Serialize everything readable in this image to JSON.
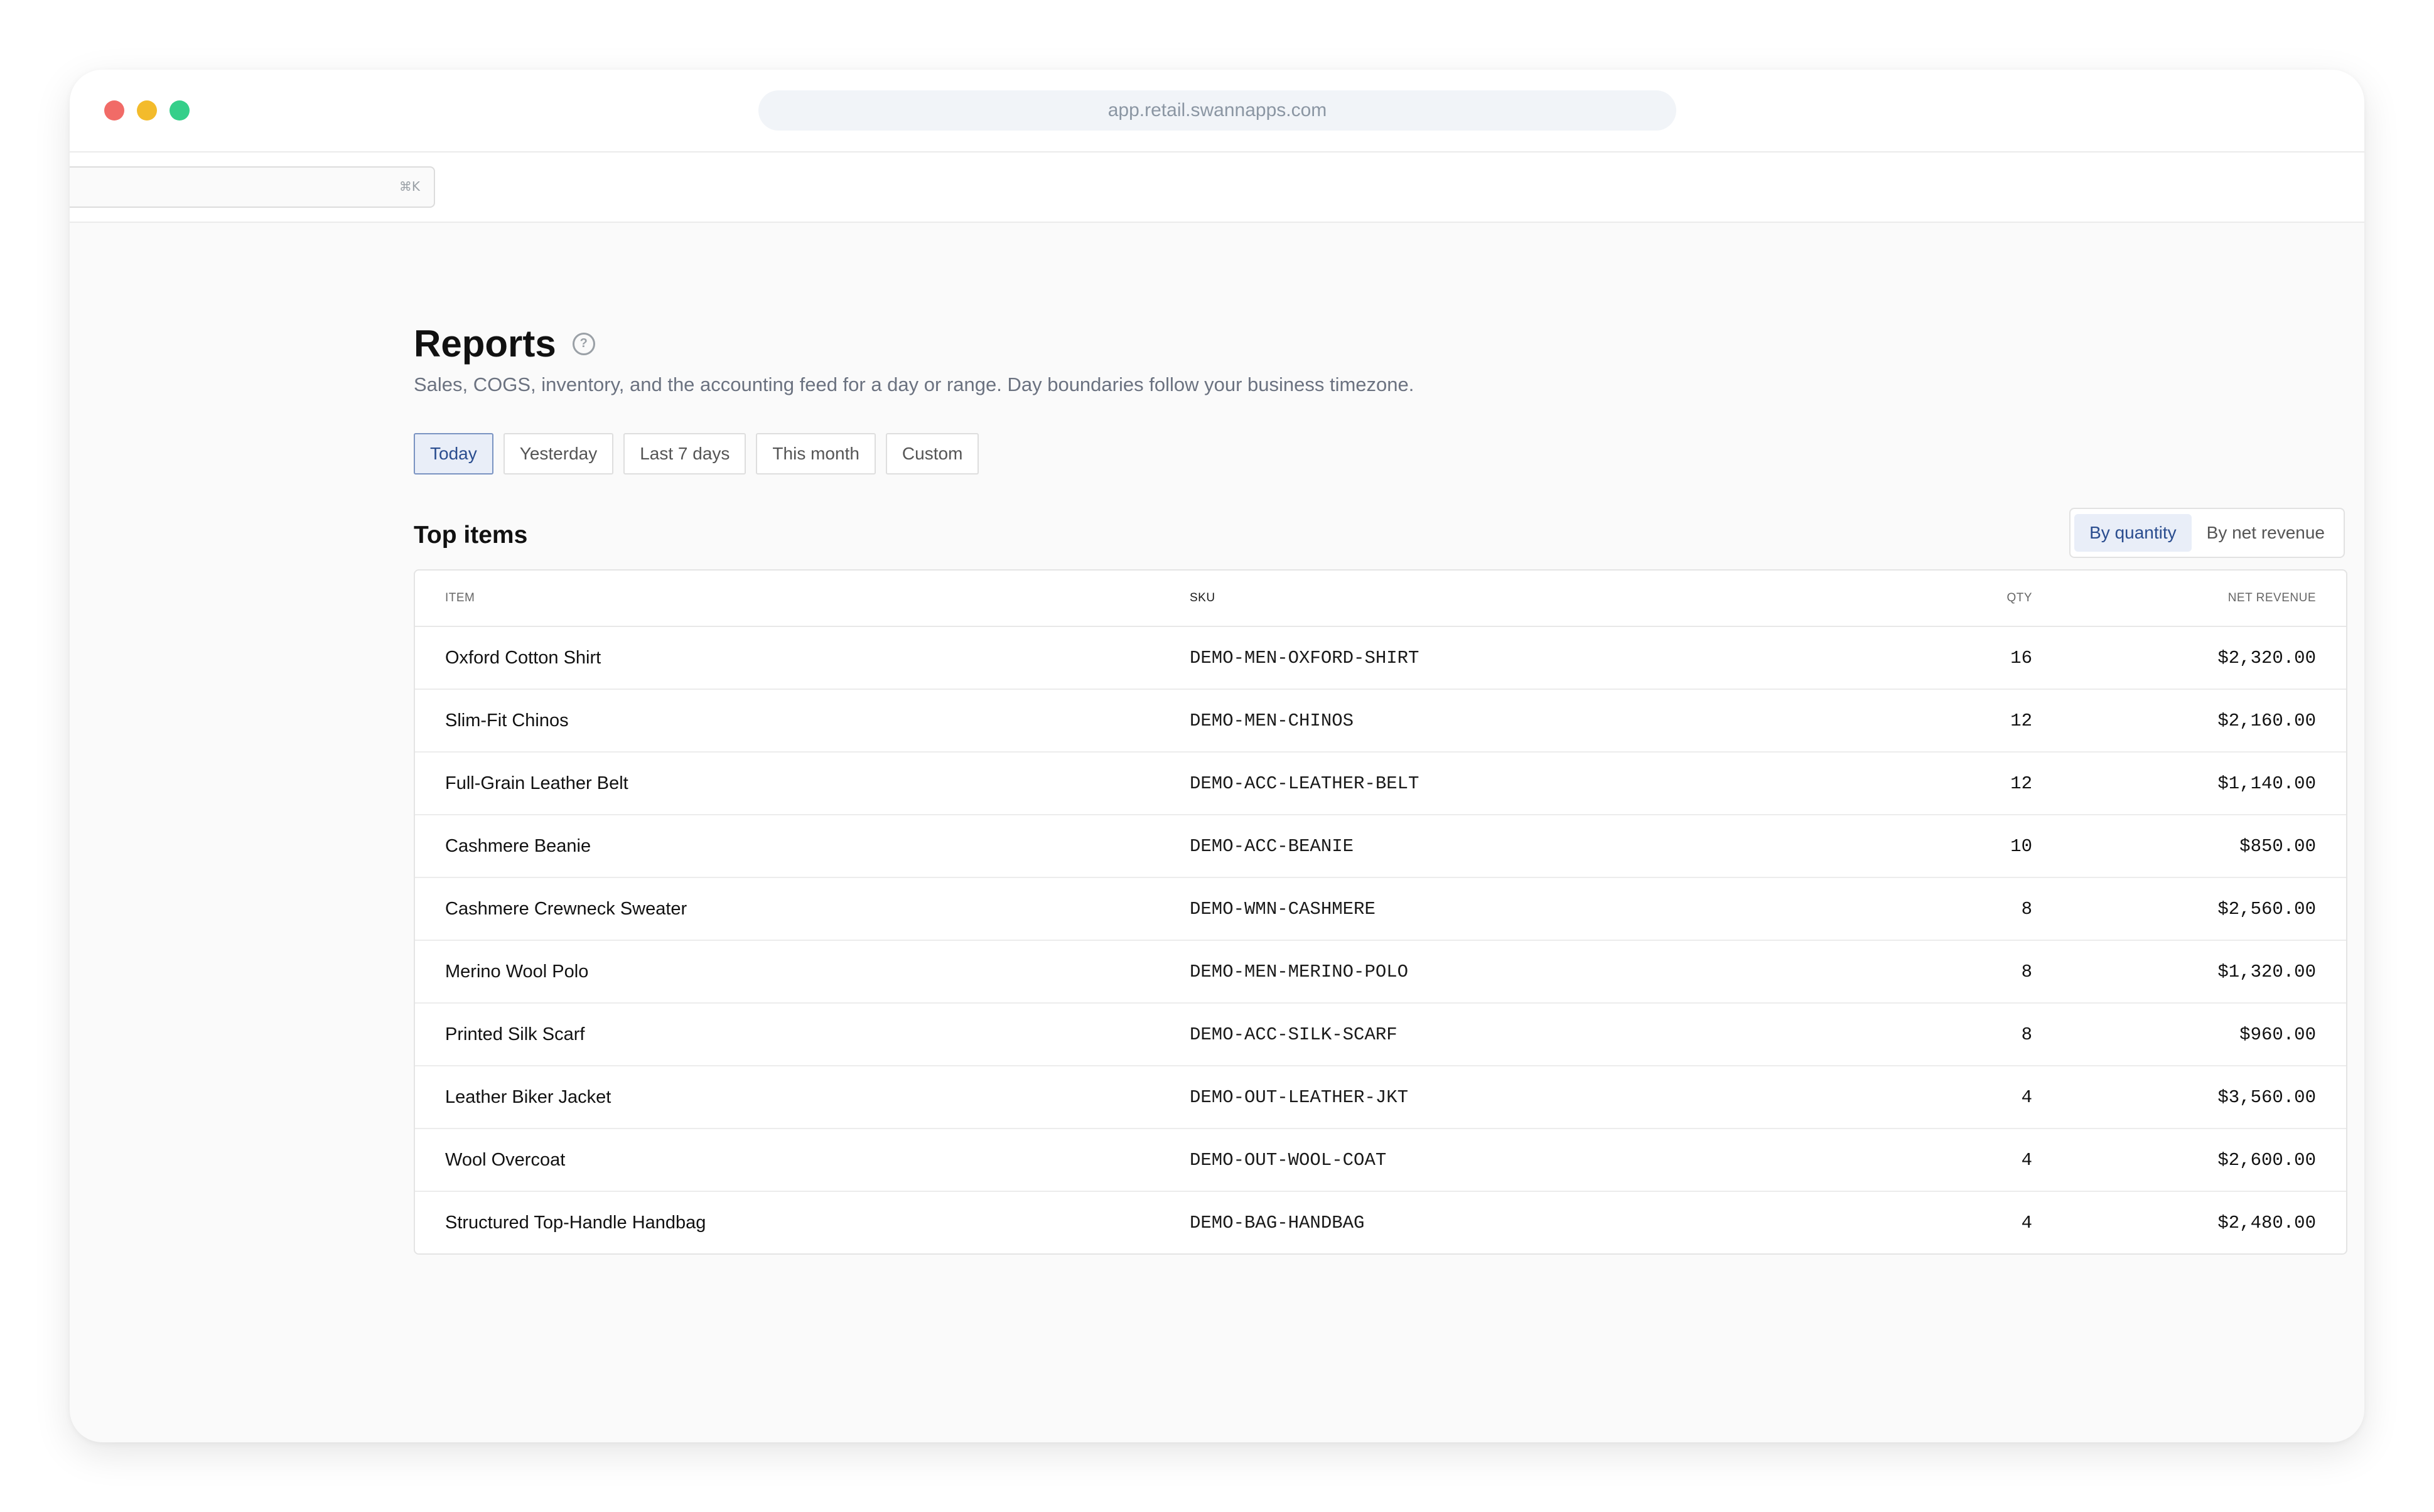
{
  "browser": {
    "url": "app.retail.swannapps.com"
  },
  "topbar": {
    "search_shortcut": "⌘K"
  },
  "page": {
    "title": "Reports",
    "subtitle": "Sales, COGS, inventory, and the accounting feed for a day or range. Day boundaries follow your business timezone."
  },
  "ranges": [
    {
      "label": "Today",
      "active": true
    },
    {
      "label": "Yesterday",
      "active": false
    },
    {
      "label": "Last 7 days",
      "active": false
    },
    {
      "label": "This month",
      "active": false
    },
    {
      "label": "Custom",
      "active": false
    }
  ],
  "top_items": {
    "title": "Top items",
    "toggle": {
      "by_quantity": "By quantity",
      "by_net_revenue": "By net revenue",
      "active": "By quantity"
    },
    "columns": {
      "item": "ITEM",
      "sku": "SKU",
      "qty": "QTY",
      "net_revenue": "NET REVENUE"
    },
    "rows": [
      {
        "item": "Oxford Cotton Shirt",
        "sku": "DEMO-MEN-OXFORD-SHIRT",
        "qty": "16",
        "revenue": "$2,320.00"
      },
      {
        "item": "Slim-Fit Chinos",
        "sku": "DEMO-MEN-CHINOS",
        "qty": "12",
        "revenue": "$2,160.00"
      },
      {
        "item": "Full-Grain Leather Belt",
        "sku": "DEMO-ACC-LEATHER-BELT",
        "qty": "12",
        "revenue": "$1,140.00"
      },
      {
        "item": "Cashmere Beanie",
        "sku": "DEMO-ACC-BEANIE",
        "qty": "10",
        "revenue": "$850.00"
      },
      {
        "item": "Cashmere Crewneck Sweater",
        "sku": "DEMO-WMN-CASHMERE",
        "qty": "8",
        "revenue": "$2,560.00"
      },
      {
        "item": "Merino Wool Polo",
        "sku": "DEMO-MEN-MERINO-POLO",
        "qty": "8",
        "revenue": "$1,320.00"
      },
      {
        "item": "Printed Silk Scarf",
        "sku": "DEMO-ACC-SILK-SCARF",
        "qty": "8",
        "revenue": "$960.00"
      },
      {
        "item": "Leather Biker Jacket",
        "sku": "DEMO-OUT-LEATHER-JKT",
        "qty": "4",
        "revenue": "$3,560.00"
      },
      {
        "item": "Wool Overcoat",
        "sku": "DEMO-OUT-WOOL-COAT",
        "qty": "4",
        "revenue": "$2,600.00"
      },
      {
        "item": "Structured Top-Handle Handbag",
        "sku": "DEMO-BAG-HANDBAG",
        "qty": "4",
        "revenue": "$2,480.00"
      }
    ]
  },
  "colors": {
    "accent": "#2a4d8f",
    "accent_bg": "#e9eef8",
    "traffic_red": "#f16b67",
    "traffic_yellow": "#f3bb2b",
    "traffic_green": "#35cf8a"
  }
}
